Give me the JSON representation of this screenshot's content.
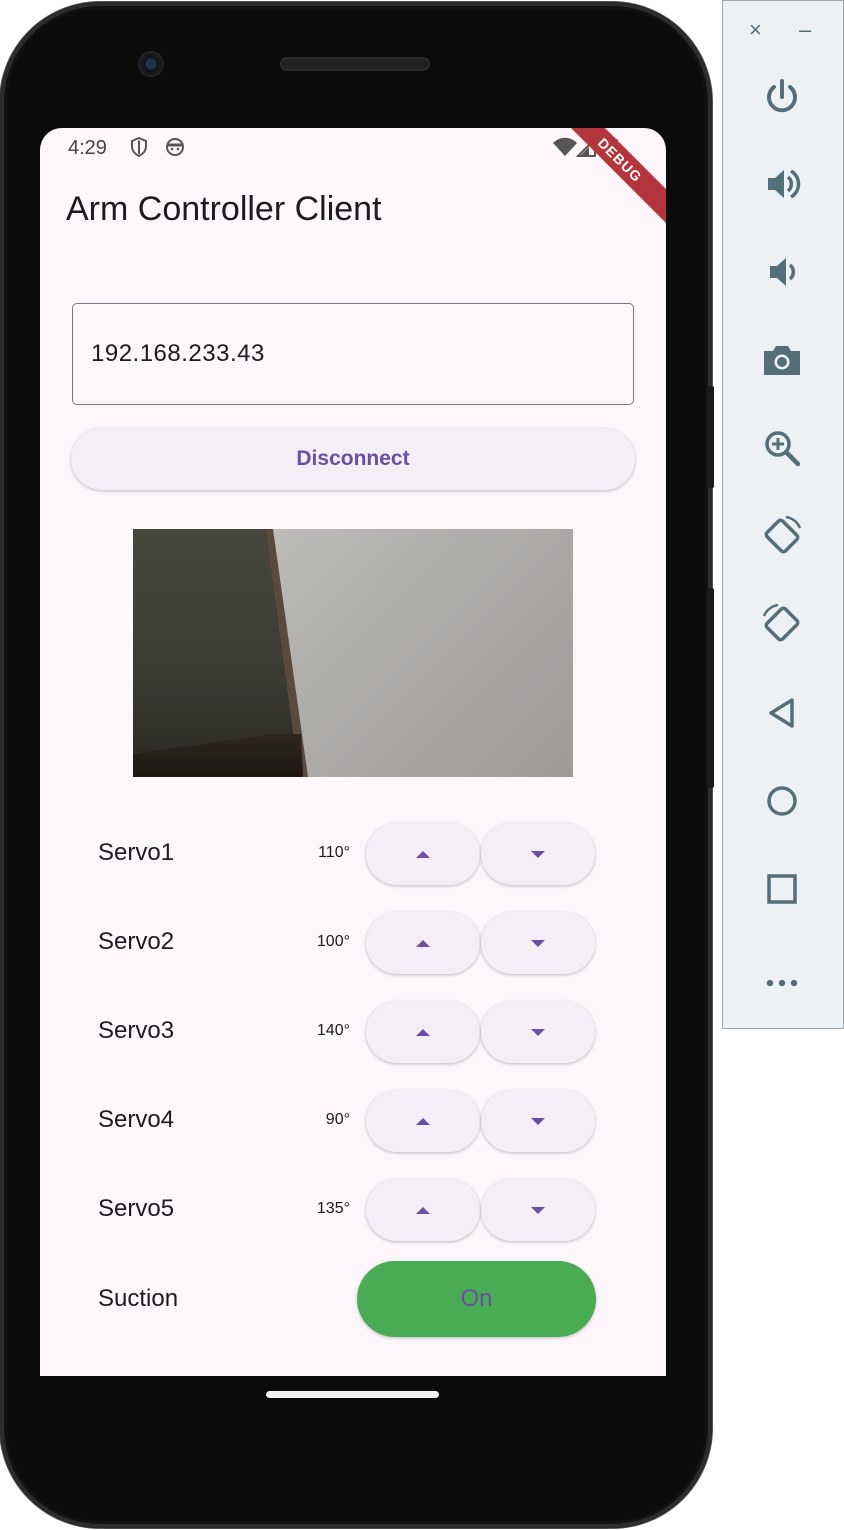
{
  "status_bar": {
    "time": "4:29",
    "debug_banner": "DEBUG"
  },
  "app": {
    "title": "Arm Controller Client"
  },
  "connection": {
    "ip_value": "192.168.233.43",
    "button_label": "Disconnect"
  },
  "servos": [
    {
      "name": "Servo1",
      "value": "110°"
    },
    {
      "name": "Servo2",
      "value": "100°"
    },
    {
      "name": "Servo3",
      "value": "140°"
    },
    {
      "name": "Servo4",
      "value": "90°"
    },
    {
      "name": "Servo5",
      "value": "135°"
    }
  ],
  "suction": {
    "label": "Suction",
    "toggle_label": "On",
    "toggle_color": "#4aab55"
  },
  "emulator_toolbar": {
    "close": "×",
    "minimize": "–",
    "icons": [
      "power-icon",
      "volume-up-icon",
      "volume-down-icon",
      "camera-icon",
      "zoom-icon",
      "rotate-left-icon",
      "rotate-right-icon",
      "back-icon",
      "home-icon",
      "overview-icon",
      "more-icon"
    ]
  },
  "colors": {
    "accent": "#6a4fa3",
    "screen_bg": "#fdf7fc",
    "button_bg": "#f4eff7",
    "toolbar_icon": "#546e7a"
  }
}
